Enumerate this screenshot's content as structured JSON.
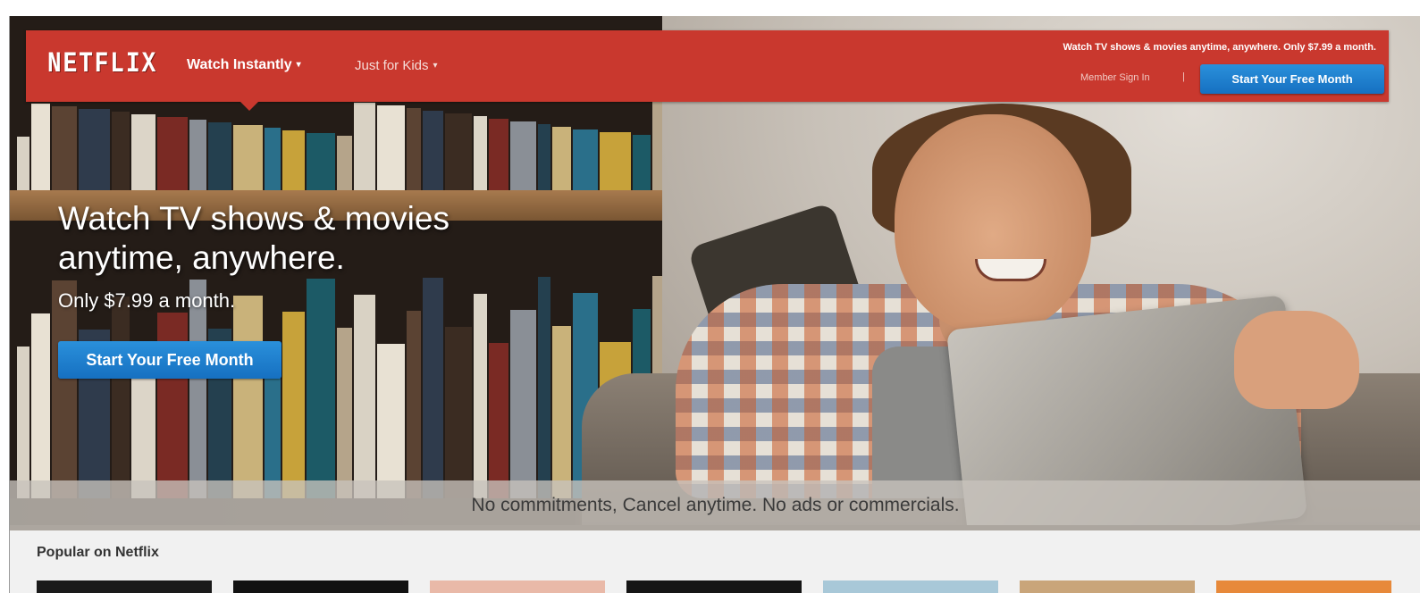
{
  "header": {
    "logo_text": "NETFLIX",
    "nav": [
      {
        "label": "Watch Instantly",
        "caret": "▾"
      },
      {
        "label": "Just for Kids",
        "caret": "▾"
      }
    ],
    "tagline": "Watch TV shows & movies anytime, anywhere. Only $7.99 a month.",
    "member_sign_in": "Member Sign In",
    "separator": "|",
    "cta_label": "Start Your Free Month"
  },
  "hero": {
    "title": "Watch TV shows & movies anytime, anywhere.",
    "price": "Only $7.99 a month.",
    "cta_label": "Start Your Free Month"
  },
  "strip": {
    "text": "No commitments, Cancel anytime. No ads or commercials."
  },
  "popular": {
    "title": "Popular on Netflix",
    "posters": [
      "#1a1a1a",
      "#121212",
      "#e9b9a8",
      "#151515",
      "#a8c8d8",
      "#c9a57a",
      "#e7893a"
    ]
  },
  "colors": {
    "brand_red": "#c9382e",
    "button_blue": "#1a7bcf"
  }
}
